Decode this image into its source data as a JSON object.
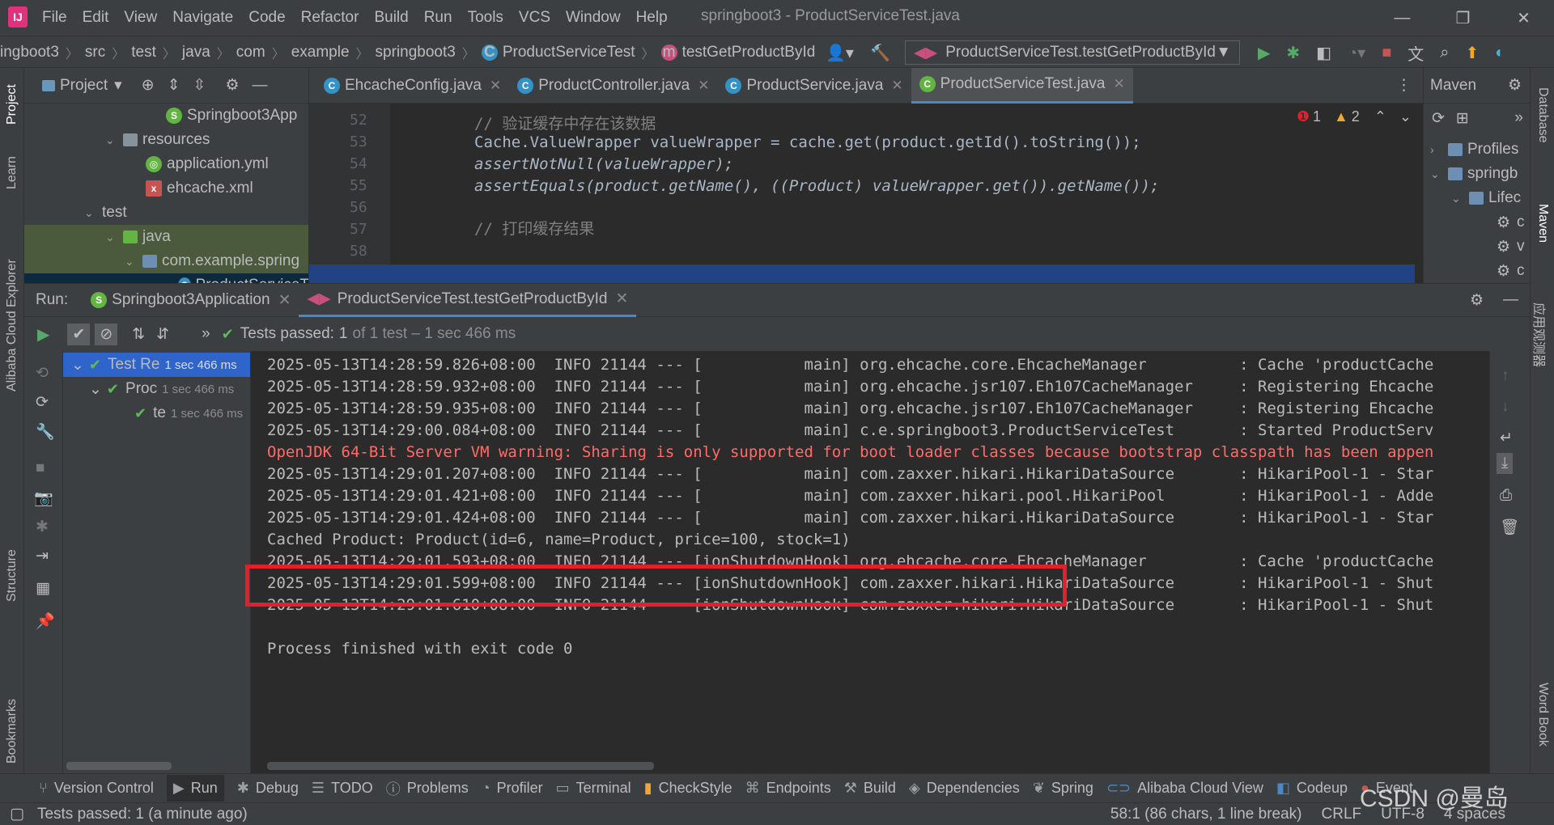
{
  "window": {
    "title": "springboot3 - ProductServiceTest.java",
    "menus": [
      "File",
      "Edit",
      "View",
      "Navigate",
      "Code",
      "Refactor",
      "Build",
      "Run",
      "Tools",
      "VCS",
      "Window",
      "Help"
    ],
    "controls": {
      "minimize": "—",
      "restore": "❐",
      "close": "✕"
    }
  },
  "breadcrumb": {
    "items": [
      "ingboot3",
      "src",
      "test",
      "java",
      "com",
      "example",
      "springboot3",
      "ProductServiceTest",
      "testGetProductById"
    ],
    "run_config": "ProductServiceTest.testGetProductById"
  },
  "left_strip": [
    "Project",
    "Learn",
    "Alibaba Cloud Explorer",
    "Structure",
    "Bookmarks"
  ],
  "right_strip": [
    "Database",
    "Maven",
    "应用观测器",
    "Word Book"
  ],
  "project": {
    "title": "Project",
    "tree": [
      {
        "label": "Springboot3App",
        "icon": "spring-icon"
      },
      {
        "label": "resources",
        "icon": "folder-icon"
      },
      {
        "label": "application.yml",
        "icon": "yml-icon"
      },
      {
        "label": "ehcache.xml",
        "icon": "xml-icon"
      },
      {
        "label": "test",
        "icon": "folder-icon"
      },
      {
        "label": "java",
        "icon": "folder-icon"
      },
      {
        "label": "com.example.spring",
        "icon": "package-icon"
      },
      {
        "label": "ProductServiceT",
        "icon": "class-icon"
      }
    ]
  },
  "editor": {
    "tabs": [
      "EhcacheConfig.java",
      "ProductController.java",
      "ProductService.java",
      "ProductServiceTest.java"
    ],
    "active_tab": "ProductServiceTest.java",
    "errors": "1",
    "warnings": "2",
    "lines": [
      {
        "num": "52",
        "text": ""
      },
      {
        "num": "53",
        "text": "// 验证缓存中存在该数据"
      },
      {
        "num": "54",
        "text": "Cache.ValueWrapper valueWrapper = cache.get(product.getId().toString());"
      },
      {
        "num": "55",
        "text": "assertNotNull(valueWrapper);"
      },
      {
        "num": "56",
        "text": "assertEquals(product.getName(), ((Product) valueWrapper.get()).getName());"
      },
      {
        "num": "57",
        "text": ""
      },
      {
        "num": "58",
        "text": "// 打印缓存结果"
      }
    ]
  },
  "maven": {
    "title": "Maven",
    "items": [
      "Profiles",
      "springb",
      "Lifec",
      "c",
      "v",
      "c"
    ]
  },
  "run": {
    "label": "Run:",
    "tabs": [
      "Springboot3Application",
      "ProductServiceTest.testGetProductById"
    ],
    "status_prefix": "Tests passed:",
    "status_count": "1",
    "status_rest": "of 1 test – 1 sec 466 ms",
    "test_tree": [
      {
        "label": "Test Re",
        "time": "1 sec 466 ms"
      },
      {
        "label": "Proc",
        "time": "1 sec 466 ms"
      },
      {
        "label": "te",
        "time": "1 sec 466 ms"
      }
    ],
    "console": [
      {
        "text": "2025-05-13T14:28:59.826+08:00  INFO 21144 --- [           main] org.ehcache.core.EhcacheManager          : Cache 'productCache",
        "type": "info"
      },
      {
        "text": "2025-05-13T14:28:59.932+08:00  INFO 21144 --- [           main] org.ehcache.jsr107.Eh107CacheManager     : Registering Ehcache",
        "type": "info"
      },
      {
        "text": "2025-05-13T14:28:59.935+08:00  INFO 21144 --- [           main] org.ehcache.jsr107.Eh107CacheManager     : Registering Ehcache",
        "type": "info"
      },
      {
        "text": "2025-05-13T14:29:00.084+08:00  INFO 21144 --- [           main] c.e.springboot3.ProductServiceTest       : Started ProductServ",
        "type": "info"
      },
      {
        "text": "OpenJDK 64-Bit Server VM warning: Sharing is only supported for boot loader classes because bootstrap classpath has been appen",
        "type": "err"
      },
      {
        "text": "2025-05-13T14:29:01.207+08:00  INFO 21144 --- [           main] com.zaxxer.hikari.HikariDataSource       : HikariPool-1 - Star",
        "type": "info"
      },
      {
        "text": "2025-05-13T14:29:01.421+08:00  INFO 21144 --- [           main] com.zaxxer.hikari.pool.HikariPool        : HikariPool-1 - Adde",
        "type": "info"
      },
      {
        "text": "2025-05-13T14:29:01.424+08:00  INFO 21144 --- [           main] com.zaxxer.hikari.HikariDataSource       : HikariPool-1 - Star",
        "type": "info"
      },
      {
        "text": "Cached Product: Product(id=6, name=Product, price=100, stock=1)",
        "type": "info"
      },
      {
        "text": "2025-05-13T14:29:01.593+08:00  INFO 21144 --- [ionShutdownHook] org.ehcache.core.EhcacheManager          : Cache 'productCache",
        "type": "info"
      },
      {
        "text": "2025-05-13T14:29:01.599+08:00  INFO 21144 --- [ionShutdownHook] com.zaxxer.hikari.HikariDataSource       : HikariPool-1 - Shut",
        "type": "info"
      },
      {
        "text": "2025-05-13T14:29:01.610+08:00  INFO 21144 --- [ionShutdownHook] com.zaxxer.hikari.HikariDataSource       : HikariPool-1 - Shut",
        "type": "info"
      },
      {
        "text": "",
        "type": "info"
      },
      {
        "text": "Process finished with exit code 0",
        "type": "info"
      }
    ]
  },
  "bottom_tools": [
    "Version Control",
    "Run",
    "Debug",
    "TODO",
    "Problems",
    "Profiler",
    "Terminal",
    "CheckStyle",
    "Endpoints",
    "Build",
    "Dependencies",
    "Spring",
    "Alibaba Cloud View",
    "Codeup",
    "Event"
  ],
  "status": {
    "message": "Tests passed: 1 (a minute ago)",
    "position": "58:1 (86 chars, 1 line break)",
    "line_sep": "CRLF",
    "encoding": "UTF-8",
    "indent": "4 spaces"
  },
  "watermark": "CSDN @曼岛",
  "colors": {
    "highlight": "#e0202a",
    "error_text": "#ff6b68",
    "pass": "#5fb85f",
    "accent": "#4a88c7"
  }
}
